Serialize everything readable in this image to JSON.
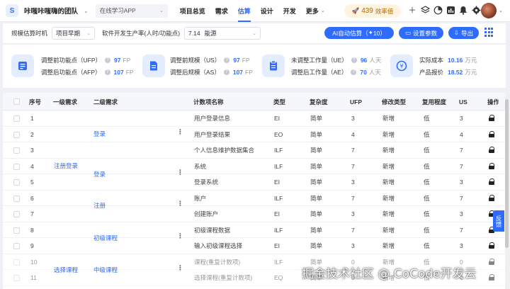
{
  "header": {
    "team_name": "咔嗤咔嗤嗨的团队",
    "project_select": "在线学习APP",
    "nav": [
      "项目总览",
      "需求",
      "估算",
      "设计",
      "开发",
      "更多"
    ],
    "active_nav": "估算",
    "efficiency_value": "439",
    "efficiency_label": "效率值"
  },
  "filters": {
    "scale_label": "规模估算时机",
    "scale_value": "项目早期",
    "rate_label": "软件开发生产率(人时/功能点)",
    "rate_value": "7.14",
    "rate_source": "能源",
    "ai_button": "AI自动估算（",
    "ai_count": "10",
    "ai_close": "）",
    "settings_button": "设置参数",
    "export_button": "导出"
  },
  "summary": {
    "ufp_label": "调整前功能点（UFP）",
    "ufp_value": "97",
    "afp_label": "调整后功能点（AFP）",
    "afp_value": "107",
    "fp_unit": "FP",
    "us_label": "调整前规模（US）",
    "us_value": "97",
    "as_label": "调整后规模（AS）",
    "as_value": "107",
    "ue_label": "未调整工作量（UE）",
    "ue_value": "96",
    "ae_label": "调整后工作量（AE）",
    "ae_value": "70",
    "effort_unit": "人天",
    "cost_label": "实际成本",
    "cost_value": "10.16",
    "quote_label": "产品报价",
    "quote_value": "18.52",
    "money_unit": "万元"
  },
  "table": {
    "columns": [
      "序号",
      "一级需求",
      "二级需求",
      "计数项名称",
      "类型",
      "复杂度",
      "UFP",
      "修改类型",
      "复用程度",
      "US",
      "操作"
    ],
    "rows": [
      {
        "no": "1",
        "name": "用户登录信息",
        "type": "EI",
        "complexity": "简单",
        "ufp": "3",
        "change": "新增",
        "reuse": "低",
        "us": "3"
      },
      {
        "no": "2",
        "name": "用户登录结果",
        "type": "EO",
        "complexity": "简单",
        "ufp": "4",
        "change": "新增",
        "reuse": "低",
        "us": "4"
      },
      {
        "no": "3",
        "name": "个人信息维护数据集合",
        "type": "ILF",
        "complexity": "简单",
        "ufp": "7",
        "change": "新增",
        "reuse": "低",
        "us": "7"
      },
      {
        "no": "4",
        "name": "系统",
        "type": "ILF",
        "complexity": "简单",
        "ufp": "7",
        "change": "新增",
        "reuse": "低",
        "us": "7"
      },
      {
        "no": "5",
        "name": "登录系统",
        "type": "EI",
        "complexity": "简单",
        "ufp": "3",
        "change": "新增",
        "reuse": "低",
        "us": "3"
      },
      {
        "no": "6",
        "name": "账户",
        "type": "ILF",
        "complexity": "简单",
        "ufp": "7",
        "change": "新增",
        "reuse": "低",
        "us": "7"
      },
      {
        "no": "7",
        "name": "创建账户",
        "type": "EI",
        "complexity": "简单",
        "ufp": "3",
        "change": "新增",
        "reuse": "低",
        "us": "3"
      },
      {
        "no": "8",
        "name": "初级课程数据",
        "type": "ILF",
        "complexity": "简单",
        "ufp": "7",
        "change": "新增",
        "reuse": "低",
        "us": "7"
      },
      {
        "no": "9",
        "name": "输入初级课程选择",
        "type": "EI",
        "complexity": "简单",
        "ufp": "3",
        "change": "新增",
        "reuse": "低",
        "us": "3"
      },
      {
        "no": "10",
        "name": "课程(重复计数项)",
        "type": "ILF",
        "complexity": "简单",
        "ufp": "0",
        "change": "新增",
        "reuse": "低",
        "us": "0"
      },
      {
        "no": "11",
        "name": "选择课程(重复计数项)",
        "type": "EQ",
        "complexity": "简单",
        "ufp": "0",
        "change": "新增",
        "reuse": "低",
        "us": "0"
      }
    ],
    "groups": {
      "l1_register": "注册登录",
      "l1_select": "选择课程",
      "l2_login_a": "登录",
      "l2_login_b": "登录",
      "l2_register": "注册",
      "l2_basic": "初级课程",
      "l2_mid": "中级课程"
    }
  },
  "feedback_label": "反馈",
  "watermark": "掘金技术社区 @ CoCode开发云",
  "colors": {
    "accent": "#2f6bff",
    "cost_unit": "#999999"
  }
}
